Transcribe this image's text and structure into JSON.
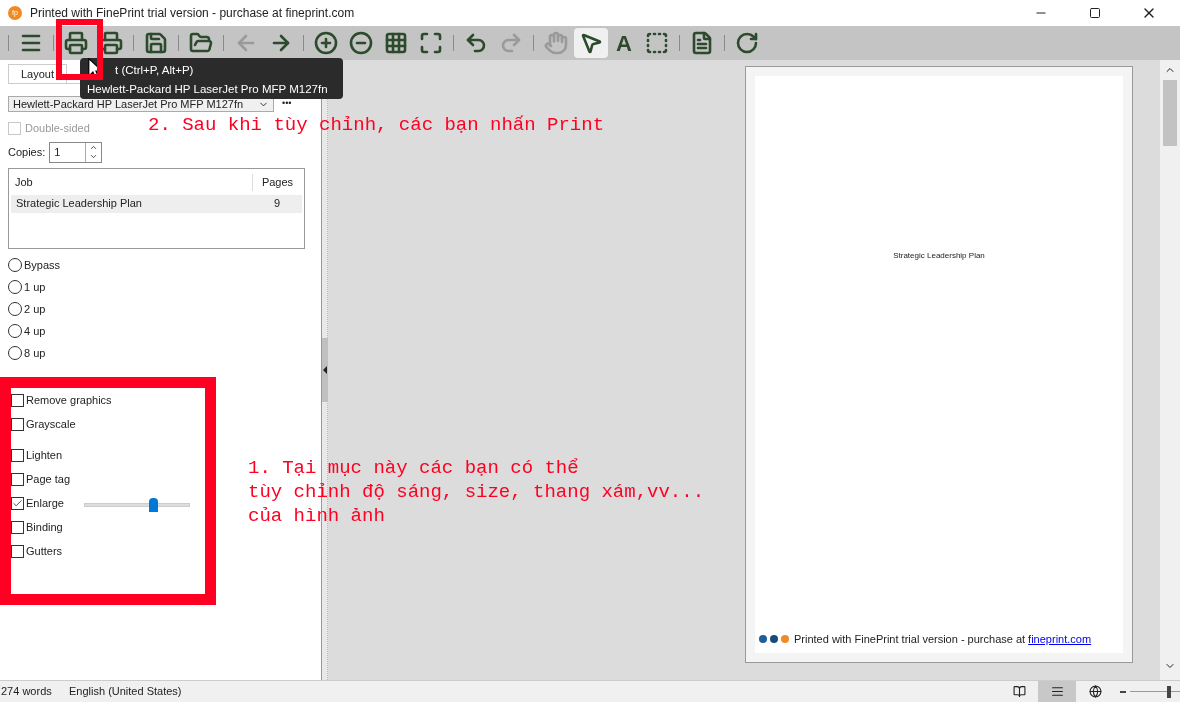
{
  "window": {
    "title": "Printed with FinePrint trial version - purchase at fineprint.com",
    "app_icon": "fp"
  },
  "toolbar": [
    {
      "kind": "separator"
    },
    {
      "kind": "menu",
      "disabled": false,
      "selected": false
    },
    {
      "kind": "separator"
    },
    {
      "kind": "print",
      "disabled": false,
      "selected": false
    },
    {
      "kind": "print-delete",
      "disabled": false,
      "selected": false
    },
    {
      "kind": "separator"
    },
    {
      "kind": "save",
      "disabled": false,
      "selected": false
    },
    {
      "kind": "separator"
    },
    {
      "kind": "open",
      "disabled": false,
      "selected": false
    },
    {
      "kind": "separator"
    },
    {
      "kind": "back",
      "disabled": true,
      "selected": false
    },
    {
      "kind": "forward",
      "disabled": false,
      "selected": false
    },
    {
      "kind": "separator"
    },
    {
      "kind": "zoom-in",
      "disabled": false,
      "selected": false
    },
    {
      "kind": "zoom-out",
      "disabled": false,
      "selected": false
    },
    {
      "kind": "grid",
      "disabled": false,
      "selected": false
    },
    {
      "kind": "fit",
      "disabled": false,
      "selected": false
    },
    {
      "kind": "separator"
    },
    {
      "kind": "undo",
      "disabled": false,
      "selected": false
    },
    {
      "kind": "redo",
      "disabled": true,
      "selected": false
    },
    {
      "kind": "separator"
    },
    {
      "kind": "hand",
      "disabled": true,
      "selected": false
    },
    {
      "kind": "pointer",
      "disabled": false,
      "selected": true
    },
    {
      "kind": "text",
      "label": "A",
      "disabled": false,
      "selected": false
    },
    {
      "kind": "select",
      "disabled": false,
      "selected": false
    },
    {
      "kind": "separator"
    },
    {
      "kind": "notes",
      "disabled": false,
      "selected": false
    },
    {
      "kind": "separator"
    },
    {
      "kind": "refresh",
      "disabled": false,
      "selected": false
    }
  ],
  "tooltip": {
    "lines": [
      "t (Ctrl+P, Alt+P)",
      "Hewlett-Packard HP LaserJet Pro MFP M127fn"
    ]
  },
  "left_panel": {
    "tabs": [
      {
        "label": "Layout",
        "selected": true
      }
    ],
    "printer": {
      "value": "Hewlett-Packard HP LaserJet Pro MFP M127fn",
      "more": "•••"
    },
    "double_sided": {
      "label": "Double-sided",
      "checked": false,
      "disabled": true
    },
    "copies": {
      "label": "Copies:",
      "value": "1"
    },
    "jobs": {
      "columns": [
        "Job",
        "Pages"
      ],
      "rows": [
        {
          "job": "Strategic Leadership Plan",
          "pages": "9",
          "selected": true
        }
      ]
    },
    "layouts": [
      {
        "label": "Bypass",
        "selected": false
      },
      {
        "label": "1 up",
        "selected": false
      },
      {
        "label": "2 up",
        "selected": false
      },
      {
        "label": "4 up",
        "selected": false
      },
      {
        "label": "8 up",
        "selected": false
      }
    ],
    "options": [
      {
        "kind": "checkbox",
        "label": "Remove graphics",
        "checked": false
      },
      {
        "kind": "checkbox",
        "label": "Grayscale",
        "checked": false
      },
      {
        "kind": "checkbox",
        "label": "Lighten",
        "checked": false
      },
      {
        "kind": "checkbox",
        "label": "Page tag",
        "checked": false
      },
      {
        "kind": "slider",
        "label": "Enlarge",
        "checked": true,
        "level": 0.65
      },
      {
        "kind": "checkbox",
        "label": "Binding",
        "checked": false
      },
      {
        "kind": "checkbox",
        "label": "Gutters",
        "checked": false
      }
    ]
  },
  "preview": {
    "page_title": "Strategic Leadership Plan",
    "footer": {
      "text": "Printed with FinePrint trial version - purchase at",
      "link": "fineprint.com",
      "dots": [
        {
          "color": "#1f5f99"
        },
        {
          "color": "#1a4a7a"
        },
        {
          "color": "#f08a24"
        }
      ]
    }
  },
  "annotations": [
    "2. Sau khi tùy chỉnh, các bạn nhấn Print",
    "1. Tại mục này các bạn có thể",
    "tùy chỉnh độ sáng, size, thang xám,vv...",
    "của hình ảnh"
  ],
  "status_bar": {
    "words": "274 words",
    "language": "English (United States)",
    "zoom": {
      "level": 0.82
    },
    "views": [
      {
        "kind": "read",
        "selected": false
      },
      {
        "kind": "print-layout",
        "selected": true
      },
      {
        "kind": "web",
        "selected": false
      }
    ]
  }
}
